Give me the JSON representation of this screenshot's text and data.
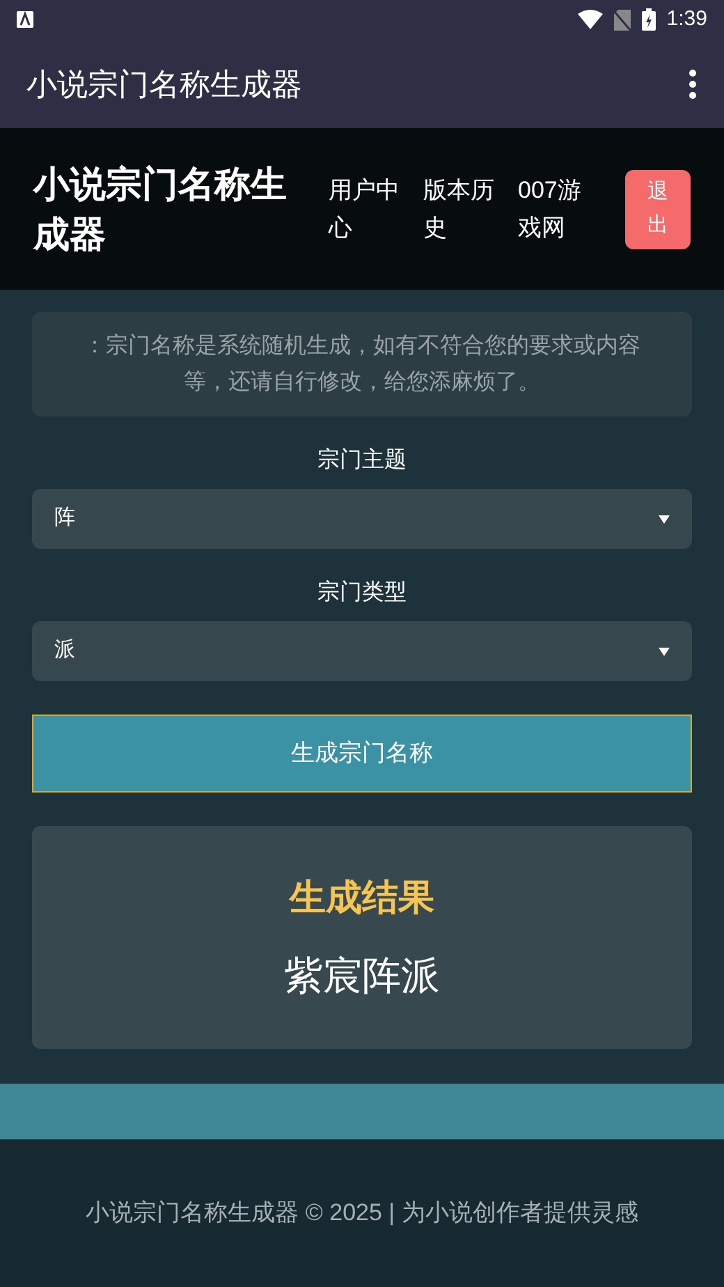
{
  "status_bar": {
    "time": "1:39"
  },
  "app_bar": {
    "title": "小说宗门名称生成器"
  },
  "header": {
    "title": "小说宗门名称生成器",
    "nav": [
      "用户中心",
      "版本历史",
      "007游戏网"
    ],
    "logout": "退出"
  },
  "notice": "：宗门名称是系统随机生成，如有不符合您的要求或内容等，还请自行修改，给您添麻烦了。",
  "fields": [
    {
      "label": "宗门主题",
      "value": "阵"
    },
    {
      "label": "宗门类型",
      "value": "派"
    }
  ],
  "generate_button": "生成宗门名称",
  "result": {
    "title": "生成结果",
    "name": "紫宸阵派"
  },
  "footer": "小说宗门名称生成器 © 2025 | 为小说创作者提供灵感"
}
